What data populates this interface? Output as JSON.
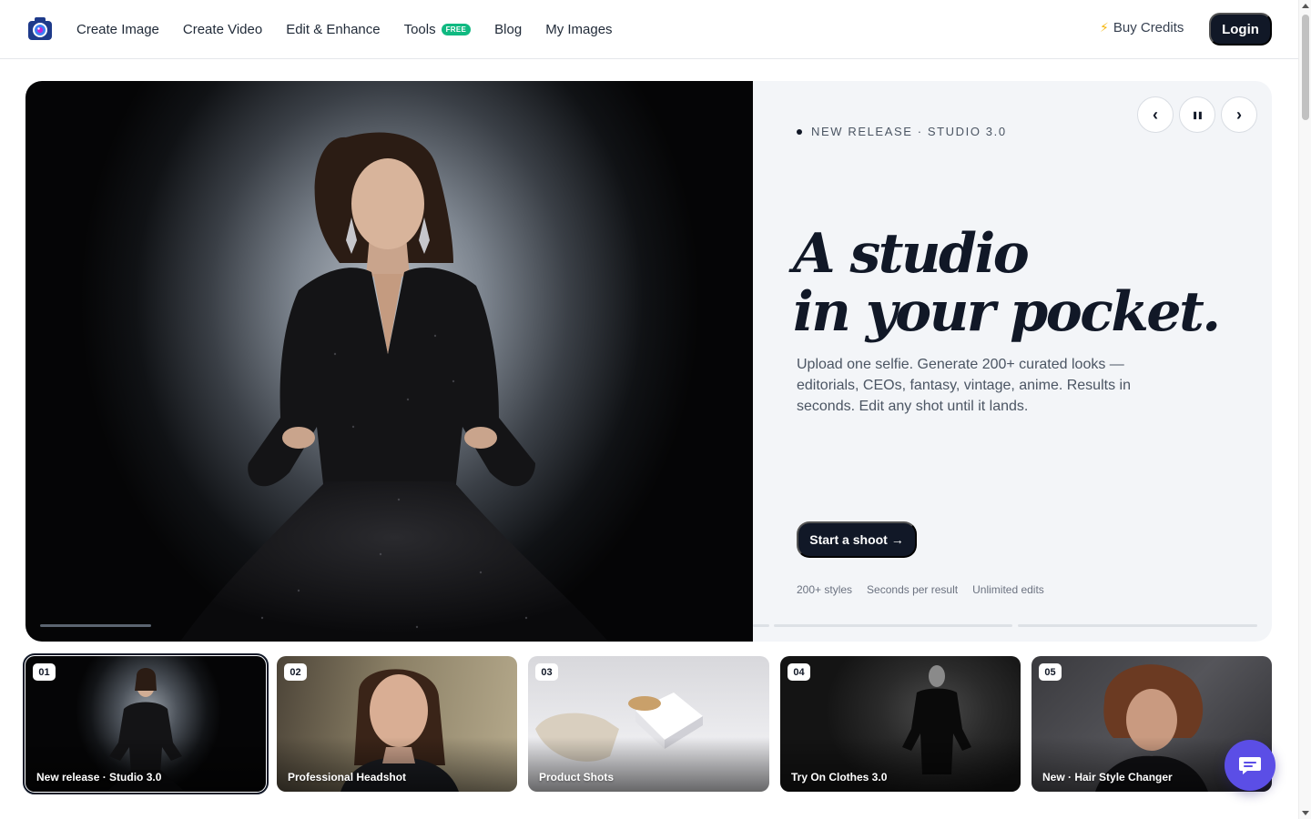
{
  "header": {
    "logo_name": "camera-logo",
    "nav": [
      {
        "label": "Create Image"
      },
      {
        "label": "Create Video"
      },
      {
        "label": "Edit & Enhance"
      },
      {
        "label": "Tools",
        "badge": "FREE"
      },
      {
        "label": "Blog"
      },
      {
        "label": "My Images"
      }
    ],
    "buy_credits": "Buy Credits",
    "login": "Login"
  },
  "hero": {
    "eyebrow": "NEW RELEASE · STUDIO 3.0",
    "title_line1": "A studio",
    "title_line2": "in your pocket.",
    "description": "Upload one selfie. Generate 200+ curated looks — editorials, CEOs, fantasy, vintage, anime. Results in seconds. Edit any shot until it lands.",
    "cta": "Start a shoot →",
    "features": [
      "200+ styles",
      "Seconds per result",
      "Unlimited edits"
    ],
    "controls": {
      "prev": "‹",
      "pause": "❚❚",
      "next": "›"
    }
  },
  "slides": [
    {
      "num": "01",
      "label": "New release · Studio 3.0",
      "active": true
    },
    {
      "num": "02",
      "label": "Professional Headshot"
    },
    {
      "num": "03",
      "label": "Product Shots"
    },
    {
      "num": "04",
      "label": "Try On Clothes 3.0"
    },
    {
      "num": "05",
      "label": "New · Hair Style Changer"
    }
  ],
  "colors": {
    "primary": "#111827",
    "free_badge": "#10b981",
    "chat": "#5b4ee6",
    "hero_panel": "#f3f5f8"
  }
}
